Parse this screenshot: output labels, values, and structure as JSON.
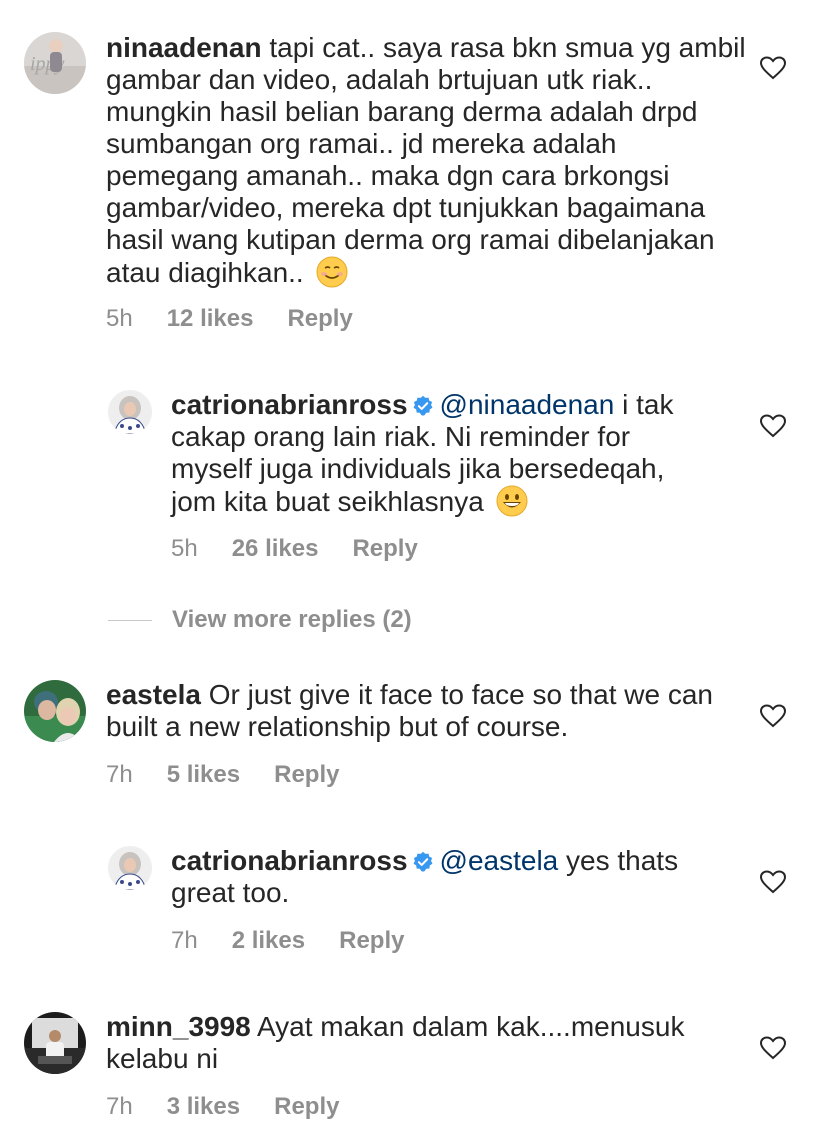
{
  "comments": [
    {
      "username": "ninaadenan",
      "text": "tapi cat.. saya rasa bkn smua yg ambil gambar dan video, adalah brtujuan utk riak.. mungkin hasil belian barang derma adalah drpd sumbangan org ramai.. jd mereka adalah pemegang amanah.. maka dgn cara brkongsi gambar/video,  mereka dpt tunjukkan bagaimana hasil wang kutipan derma org ramai dibelanjakan atau diagihkan..",
      "emoji": "smiling-face-icon",
      "time": "5h",
      "likes": "12 likes",
      "reply": "Reply"
    },
    {
      "username": "catrionabrianross",
      "verified": true,
      "mention": "@ninaadenan",
      "text": "i tak cakap orang lain riak. Ni reminder for myself juga individuals jika bersedeqah, jom kita buat seikhlasnya",
      "emoji": "grinning-face-icon",
      "time": "5h",
      "likes": "26 likes",
      "reply": "Reply"
    },
    {
      "username": "eastela",
      "text": "Or just give it face to face so that we can built a new relationship but of course.",
      "time": "7h",
      "likes": "5 likes",
      "reply": "Reply"
    },
    {
      "username": "catrionabrianross",
      "verified": true,
      "mention": "@eastela",
      "text": "yes thats great too.",
      "time": "7h",
      "likes": "2 likes",
      "reply": "Reply"
    },
    {
      "username": "minn_3998",
      "text": "Ayat makan dalam kak....menusuk kelabu ni",
      "time": "7h",
      "likes": "3 likes",
      "reply": "Reply"
    }
  ],
  "view_more": "View more replies (2)",
  "colors": {
    "text": "#262626",
    "meta": "#8e8e8e",
    "mention": "#003569",
    "verified": "#3897f0"
  }
}
